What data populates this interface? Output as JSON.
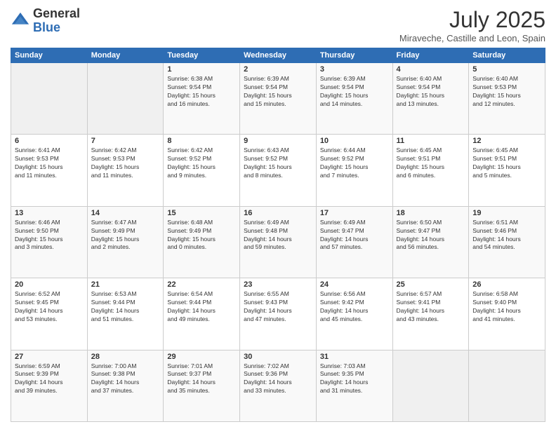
{
  "logo": {
    "general": "General",
    "blue": "Blue"
  },
  "title": "July 2025",
  "subtitle": "Miraveche, Castille and Leon, Spain",
  "days_of_week": [
    "Sunday",
    "Monday",
    "Tuesday",
    "Wednesday",
    "Thursday",
    "Friday",
    "Saturday"
  ],
  "weeks": [
    [
      {
        "day": "",
        "info": ""
      },
      {
        "day": "",
        "info": ""
      },
      {
        "day": "1",
        "info": "Sunrise: 6:38 AM\nSunset: 9:54 PM\nDaylight: 15 hours\nand 16 minutes."
      },
      {
        "day": "2",
        "info": "Sunrise: 6:39 AM\nSunset: 9:54 PM\nDaylight: 15 hours\nand 15 minutes."
      },
      {
        "day": "3",
        "info": "Sunrise: 6:39 AM\nSunset: 9:54 PM\nDaylight: 15 hours\nand 14 minutes."
      },
      {
        "day": "4",
        "info": "Sunrise: 6:40 AM\nSunset: 9:54 PM\nDaylight: 15 hours\nand 13 minutes."
      },
      {
        "day": "5",
        "info": "Sunrise: 6:40 AM\nSunset: 9:53 PM\nDaylight: 15 hours\nand 12 minutes."
      }
    ],
    [
      {
        "day": "6",
        "info": "Sunrise: 6:41 AM\nSunset: 9:53 PM\nDaylight: 15 hours\nand 11 minutes."
      },
      {
        "day": "7",
        "info": "Sunrise: 6:42 AM\nSunset: 9:53 PM\nDaylight: 15 hours\nand 11 minutes."
      },
      {
        "day": "8",
        "info": "Sunrise: 6:42 AM\nSunset: 9:52 PM\nDaylight: 15 hours\nand 9 minutes."
      },
      {
        "day": "9",
        "info": "Sunrise: 6:43 AM\nSunset: 9:52 PM\nDaylight: 15 hours\nand 8 minutes."
      },
      {
        "day": "10",
        "info": "Sunrise: 6:44 AM\nSunset: 9:52 PM\nDaylight: 15 hours\nand 7 minutes."
      },
      {
        "day": "11",
        "info": "Sunrise: 6:45 AM\nSunset: 9:51 PM\nDaylight: 15 hours\nand 6 minutes."
      },
      {
        "day": "12",
        "info": "Sunrise: 6:45 AM\nSunset: 9:51 PM\nDaylight: 15 hours\nand 5 minutes."
      }
    ],
    [
      {
        "day": "13",
        "info": "Sunrise: 6:46 AM\nSunset: 9:50 PM\nDaylight: 15 hours\nand 3 minutes."
      },
      {
        "day": "14",
        "info": "Sunrise: 6:47 AM\nSunset: 9:49 PM\nDaylight: 15 hours\nand 2 minutes."
      },
      {
        "day": "15",
        "info": "Sunrise: 6:48 AM\nSunset: 9:49 PM\nDaylight: 15 hours\nand 0 minutes."
      },
      {
        "day": "16",
        "info": "Sunrise: 6:49 AM\nSunset: 9:48 PM\nDaylight: 14 hours\nand 59 minutes."
      },
      {
        "day": "17",
        "info": "Sunrise: 6:49 AM\nSunset: 9:47 PM\nDaylight: 14 hours\nand 57 minutes."
      },
      {
        "day": "18",
        "info": "Sunrise: 6:50 AM\nSunset: 9:47 PM\nDaylight: 14 hours\nand 56 minutes."
      },
      {
        "day": "19",
        "info": "Sunrise: 6:51 AM\nSunset: 9:46 PM\nDaylight: 14 hours\nand 54 minutes."
      }
    ],
    [
      {
        "day": "20",
        "info": "Sunrise: 6:52 AM\nSunset: 9:45 PM\nDaylight: 14 hours\nand 53 minutes."
      },
      {
        "day": "21",
        "info": "Sunrise: 6:53 AM\nSunset: 9:44 PM\nDaylight: 14 hours\nand 51 minutes."
      },
      {
        "day": "22",
        "info": "Sunrise: 6:54 AM\nSunset: 9:44 PM\nDaylight: 14 hours\nand 49 minutes."
      },
      {
        "day": "23",
        "info": "Sunrise: 6:55 AM\nSunset: 9:43 PM\nDaylight: 14 hours\nand 47 minutes."
      },
      {
        "day": "24",
        "info": "Sunrise: 6:56 AM\nSunset: 9:42 PM\nDaylight: 14 hours\nand 45 minutes."
      },
      {
        "day": "25",
        "info": "Sunrise: 6:57 AM\nSunset: 9:41 PM\nDaylight: 14 hours\nand 43 minutes."
      },
      {
        "day": "26",
        "info": "Sunrise: 6:58 AM\nSunset: 9:40 PM\nDaylight: 14 hours\nand 41 minutes."
      }
    ],
    [
      {
        "day": "27",
        "info": "Sunrise: 6:59 AM\nSunset: 9:39 PM\nDaylight: 14 hours\nand 39 minutes."
      },
      {
        "day": "28",
        "info": "Sunrise: 7:00 AM\nSunset: 9:38 PM\nDaylight: 14 hours\nand 37 minutes."
      },
      {
        "day": "29",
        "info": "Sunrise: 7:01 AM\nSunset: 9:37 PM\nDaylight: 14 hours\nand 35 minutes."
      },
      {
        "day": "30",
        "info": "Sunrise: 7:02 AM\nSunset: 9:36 PM\nDaylight: 14 hours\nand 33 minutes."
      },
      {
        "day": "31",
        "info": "Sunrise: 7:03 AM\nSunset: 9:35 PM\nDaylight: 14 hours\nand 31 minutes."
      },
      {
        "day": "",
        "info": ""
      },
      {
        "day": "",
        "info": ""
      }
    ]
  ]
}
